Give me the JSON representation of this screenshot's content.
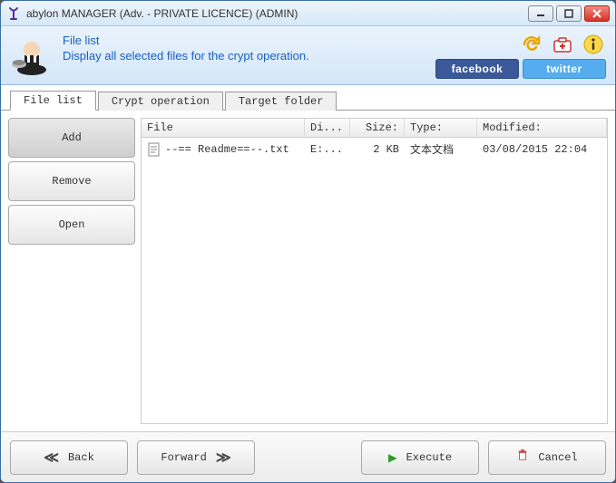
{
  "window": {
    "title": "abylon MANAGER (Adv. - PRIVATE LICENCE) (ADMIN)"
  },
  "header": {
    "section_title": "File list",
    "section_desc": "Display all selected files for the crypt operation.",
    "facebook_label": "facebook",
    "twitter_label": "twitter"
  },
  "tabs": [
    {
      "label": "File list"
    },
    {
      "label": "Crypt operation"
    },
    {
      "label": "Target folder"
    }
  ],
  "side": {
    "add": "Add",
    "remove": "Remove",
    "open": "Open"
  },
  "columns": {
    "file": "File",
    "dir": "Di...",
    "size": "Size:",
    "type": "Type:",
    "modified": "Modified:"
  },
  "files": [
    {
      "name": "--== Readme==--.txt",
      "dir": "E:...",
      "size": "2 KB",
      "type": "文本文档",
      "modified": "03/08/2015 22:04"
    }
  ],
  "nav": {
    "back": "Back",
    "forward": "Forward",
    "execute": "Execute",
    "cancel": "Cancel"
  }
}
